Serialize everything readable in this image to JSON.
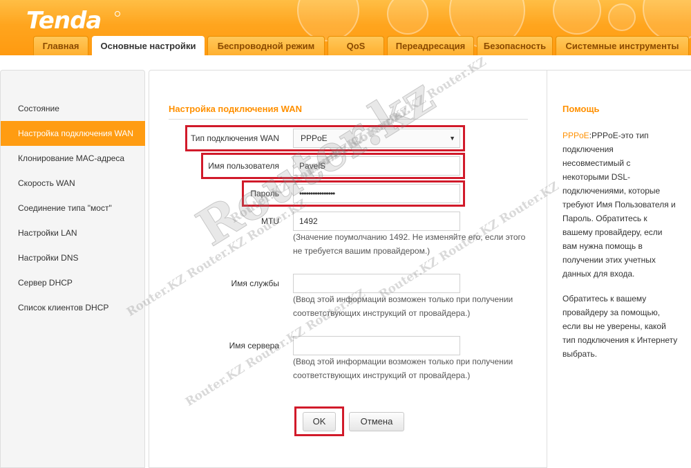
{
  "brand": {
    "logo": "Tenda"
  },
  "tabs": [
    {
      "label": "Главная"
    },
    {
      "label": "Основные настройки"
    },
    {
      "label": "Беспроводной режим"
    },
    {
      "label": "QoS"
    },
    {
      "label": "Переадресация"
    },
    {
      "label": "Безопасность"
    },
    {
      "label": "Системные инструменты"
    }
  ],
  "sidebar": {
    "items": [
      {
        "label": "Состояние"
      },
      {
        "label": "Настройка подключения WAN"
      },
      {
        "label": "Клонирование MAC-адреса"
      },
      {
        "label": "Скорость WAN"
      },
      {
        "label": "Соединение типа \"мост\""
      },
      {
        "label": "Настройки LAN"
      },
      {
        "label": "Настройки DNS"
      },
      {
        "label": "Сервер DHCP"
      },
      {
        "label": "Список клиентов DHCP"
      }
    ]
  },
  "main": {
    "title": "Настройка подключения WAN",
    "connection_type_label": "Тип подключения WAN",
    "connection_type_value": "PPPoE",
    "username_label": "Имя пользователя",
    "username_value": "PavelS",
    "password_label": "Пароль",
    "password_value": "••••••••••••••••",
    "mtu_label": "MTU",
    "mtu_value": "1492",
    "mtu_hint_1": "(Значение поумолчанию 1492. Не изменяйте его, если этого",
    "mtu_hint_2": "не требуется вашим провайдером.)",
    "service_label": "Имя службы",
    "service_value": "",
    "service_hint_1": "(Ввод этой информации возможен только при получении",
    "service_hint_2": "соответствующих инструкций от провайдера.)",
    "server_label": "Имя сервера",
    "server_value": "",
    "server_hint_1": "(Ввод этой информации возможен только при получении",
    "server_hint_2": "соответствующих инструкций от провайдера.)",
    "ok_label": "OK",
    "cancel_label": "Отмена"
  },
  "help": {
    "title": "Помощь",
    "term": "PPPoE",
    "lines_1": [
      ":PPPoE-это тип",
      "подключения",
      "несовместимый с",
      "некоторыми DSL-",
      "подключениями, которые",
      "требуют Имя Пользователя и",
      "Пароль. Обратитесь к",
      "вашему провайдеру, если",
      "вам нужна помощь в",
      "получении этих учетных",
      "данных для входа."
    ],
    "lines_2": [
      "Обратитесь к вашему",
      "провайдеру за помощью,",
      "если вы не уверены, какой",
      "тип подключения к Интернету",
      "выбрать."
    ]
  },
  "watermark": {
    "big": "Router.kz",
    "small": "Router.KZ  Router.KZ  Router.KZ"
  },
  "colors": {
    "accent": "#ff9c12",
    "highlight": "#d11a2a"
  }
}
